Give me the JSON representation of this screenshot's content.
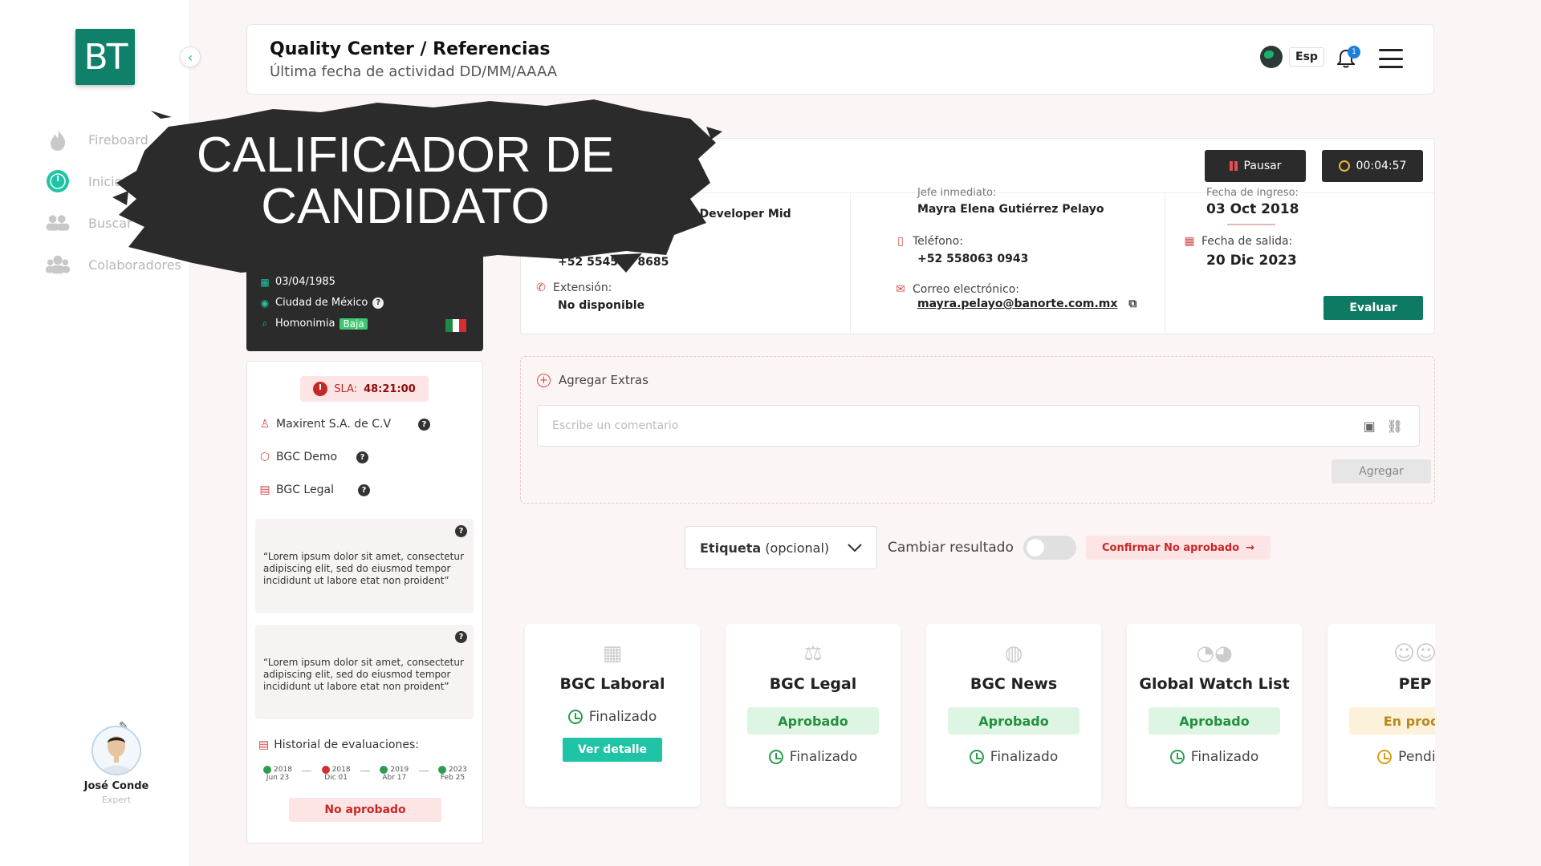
{
  "sidebar": {
    "logo_text": "BT",
    "items": [
      {
        "label": "Fireboard",
        "icon": "flame-icon"
      },
      {
        "label": "Inicio",
        "icon": "dashboard-icon"
      },
      {
        "label": "Buscar",
        "icon": "users-search-icon"
      },
      {
        "label": "Colaboradores",
        "icon": "group-icon"
      }
    ],
    "user": {
      "name": "José Conde",
      "role": "Expert"
    }
  },
  "header": {
    "title": "Quality Center / Referencias",
    "subtitle": "Última fecha de actividad DD/MM/AAAA",
    "lang": "Esp",
    "notifications": "1"
  },
  "overlay": {
    "line1": "CALIFICADOR DE",
    "line2": "CANDIDATO"
  },
  "candidate": {
    "birthdate": "03/04/1985",
    "city": "Ciudad de México",
    "homonimia_label": "Homonimia",
    "homonimia_value": "Baja"
  },
  "leftpanel": {
    "sla_label": "SLA:",
    "sla_value": "48:21:00",
    "client": "Maxirent S.A. de C.V",
    "product1": "BGC Demo",
    "product2": "BGC Legal",
    "quote1": "“Lorem ipsum dolor sit amet, consectetur adipiscing elit, sed do eiusmod tempor incididunt ut labore etat non proident”",
    "quote2": "“Lorem ipsum dolor sit amet, consectetur adipiscing elit, sed do eiusmod tempor incididunt ut labore etat non proident”",
    "history_title": "Historial de evaluaciones:",
    "history": [
      {
        "year": "2018",
        "date": "Jun 23",
        "color": "#2c9d4f"
      },
      {
        "year": "2018",
        "date": "Dic 01",
        "color": "#d32f2f"
      },
      {
        "year": "2019",
        "date": "Abr 17",
        "color": "#2c9d4f"
      },
      {
        "year": "2023",
        "date": "Feb 25",
        "color": "#2c9d4f"
      }
    ],
    "result": "No aprobado"
  },
  "info": {
    "pause_label": "Pausar",
    "timer": "00:04:57",
    "position_partial": "ck Developer Mid",
    "phone_company": "+52 554530 8685",
    "extension_label": "Extensión:",
    "extension_value": "No disponible",
    "boss_label_partial": "Jefe inmediato:",
    "boss_value": "Mayra Elena Gutiérrez Pelayo",
    "phone_label": "Teléfono:",
    "phone_value": "+52 558063 0943",
    "email_label": "Correo electrónico:",
    "email_value": "mayra.pelayo@banorte.com.mx",
    "ingreso_label_partial": "Fecha de ingreso:",
    "ingreso_value": "03 Oct 2018",
    "salida_label": "Fecha de salida:",
    "salida_value": "20 Dic 2023",
    "evaluar_label": "Evaluar"
  },
  "extras": {
    "title": "Agregar Extras",
    "placeholder": "Escribe un comentario",
    "button": "Agregar"
  },
  "result_bar": {
    "select_bold": "Etiqueta",
    "select_rest": "(opcional)",
    "toggle_label": "Cambiar resultado",
    "confirm": "Confirmar No aprobado"
  },
  "cards": [
    {
      "name": "BGC Laboral",
      "icon": "building-icon",
      "status": "",
      "state": "Finalizado",
      "button": "Ver detalle"
    },
    {
      "name": "BGC Legal",
      "icon": "scale-icon",
      "status": "Aprobado",
      "state": "Finalizado"
    },
    {
      "name": "BGC News",
      "icon": "globe-icon",
      "status": "Aprobado",
      "state": "Finalizado"
    },
    {
      "name": "Global Watch List",
      "icon": "world-map-icon",
      "status": "Aprobado",
      "state": "Finalizado"
    },
    {
      "name": "PEP",
      "icon": "people-icon",
      "status": "En proce",
      "state": "Pendien"
    }
  ],
  "colors": {
    "brand": "#0f8069",
    "accent": "#1fc4a6",
    "danger": "#c62828",
    "success": "#21913e"
  }
}
